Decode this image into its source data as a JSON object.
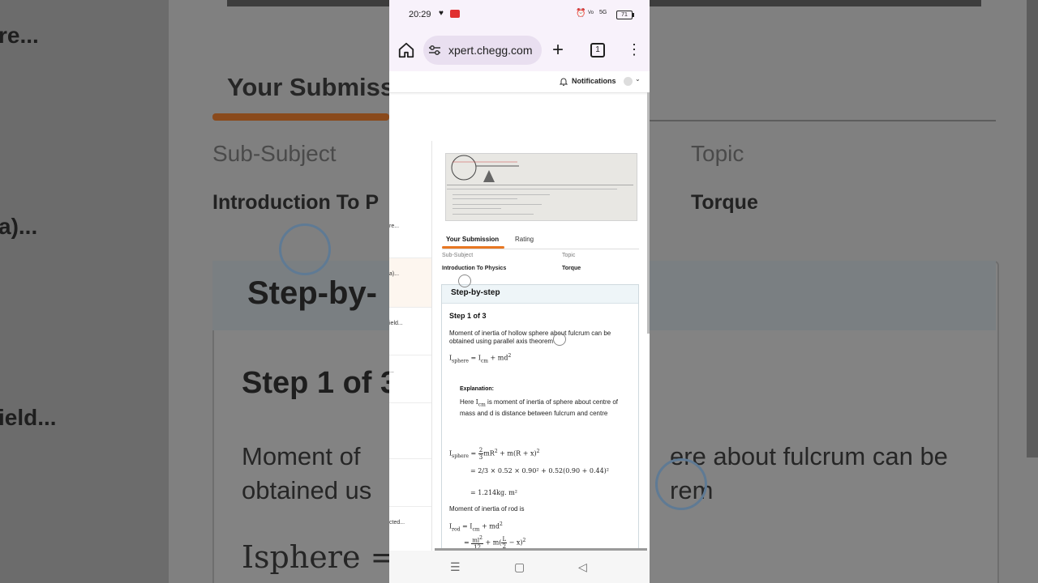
{
  "status_bar": {
    "time": "20:29",
    "network_label": "5G",
    "battery_level": "71"
  },
  "browser": {
    "url": "xpert.chegg.com",
    "tab_count": "1"
  },
  "site_header": {
    "notifications_label": "Notifications"
  },
  "sidebar": {
    "items": [
      {
        "label": "re..."
      },
      {
        "label": "a)..."
      },
      {
        "label": "ield..."
      },
      {
        "label": "..."
      },
      {
        "label": ""
      },
      {
        "label": ""
      },
      {
        "label": "cted..."
      }
    ]
  },
  "submission": {
    "tabs": [
      "Your Submission",
      "Rating"
    ],
    "sub_subject_label": "Sub-Subject",
    "sub_subject_value": "Introduction To Physics",
    "topic_label": "Topic",
    "topic_value": "Torque"
  },
  "solution": {
    "title": "Step-by-step",
    "step_label": "Step 1 of 3",
    "intro_text": "Moment of inertia of hollow sphere about fulcrum can be obtained using parallel axis theorem",
    "formula_1": "I sphere = I cm + md²",
    "explanation_title": "Explanation:",
    "explanation_text_pre": "Here",
    "explanation_text_post": "is moment of inertia of sphere about centre of mass and d is distance between fulcrum and centre",
    "calc_line_1": "= 2/3 × 0.52 × 0.90² + 0.52(0.90 + 0.44)²",
    "calc_line_2": "= 1.214kg. m²",
    "rod_text": "Moment of inertia of rod is"
  },
  "background_zoom": {
    "left_fragments": [
      "re...",
      "a)...",
      "ield..."
    ],
    "tab_label": "Your Submiss",
    "sub_subject_label": "Sub-Subject",
    "topic_label": "Topic",
    "sub_subject_value": "Introduction To P",
    "topic_value": "Torque",
    "card_title": "Step-by-",
    "step_label": "Step 1 of 3",
    "text_line_1": "Moment of",
    "text_line_1b": "ere about fulcrum can be",
    "text_line_2": "obtained us",
    "text_line_2b": "rem",
    "formula": "Isphere = Icr"
  },
  "colors": {
    "accent": "#e87722",
    "card_header": "#eef5f8",
    "browser_chrome": "#f8f2fb"
  }
}
